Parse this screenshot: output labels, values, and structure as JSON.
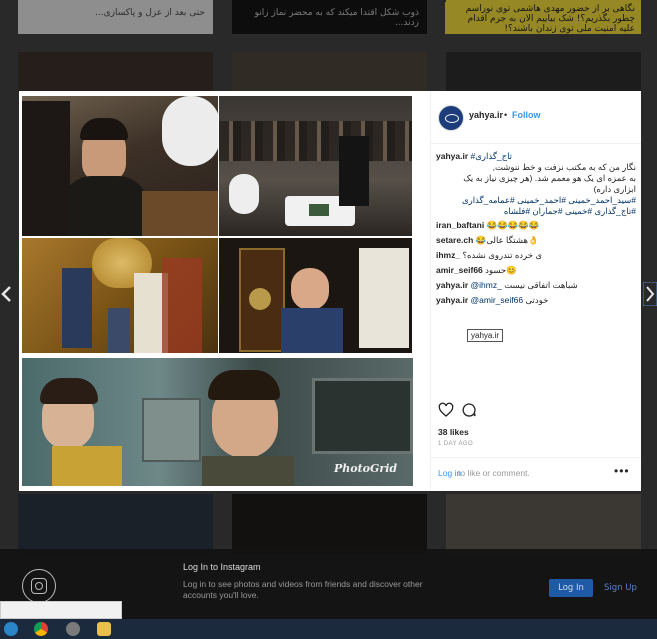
{
  "background_tiles": {
    "top_left_caption": "حتی بعد از عزل و پاکسازی...",
    "top_middle_caption": "ذوب شکل اقتدا میکند که به محضر نماز زانو زدند...",
    "top_right_caption": "نگاهی بر از حضور مهدی هاشمی توی نوراسم چطور بگذریم؟! شک بیاییم الان به جرم اقدام علیه امنیت ملی توی زندان باشند؟!"
  },
  "post": {
    "username": "yahya.ir",
    "separator": "•",
    "follow_label": "Follow",
    "photo_watermark": "PhotoGrid",
    "caption": {
      "user": "yahya.ir",
      "line1": "#تاج_گذاری",
      "line2": "نگار من که به مکتب نرفت و خط ننوشت,",
      "line3": "به عمزه ای یک هو معمم شد. (هر چیزی نیاز به یک",
      "line4": "ابزاری داره)",
      "line5": "#سید_احمد_خمینی #احمد_خمینی #عمامه_گذاری",
      "line6": "#تاج_گذاری #خمینی #جماران #فلشاه"
    },
    "comments": [
      {
        "user": "iran_baftani",
        "text": "😂😂😂😂😂"
      },
      {
        "user": "setare.ch",
        "text": "😂هشتگا عالی👌"
      },
      {
        "user": "ihmz_",
        "text": "ی خرده تندروی نشده؟"
      },
      {
        "user": "amir_seif66",
        "text": "حسود😊"
      },
      {
        "user": "yahya.ir",
        "mention": "@ihmz_",
        "text": "شباهت اتفاقی نیست"
      },
      {
        "user": "yahya.ir",
        "mention": "@amir_seif66",
        "text": "خودتی"
      }
    ],
    "tooltip": "yahya.ir",
    "likes": "38 likes",
    "time": "1 DAY AGO",
    "login_link": "Log in",
    "login_rest": "to like or comment.",
    "more_label": "•••"
  },
  "banner": {
    "title": "Log In to Instagram",
    "subtitle": "Log in to see photos and videos from friends and discover other accounts you'll love.",
    "login_button": "Log In",
    "signup_button": "Sign Up"
  },
  "colors": {
    "link_blue": "#3897f0",
    "banner_bg": "#121212",
    "taskbar": "#1b2a3d"
  }
}
